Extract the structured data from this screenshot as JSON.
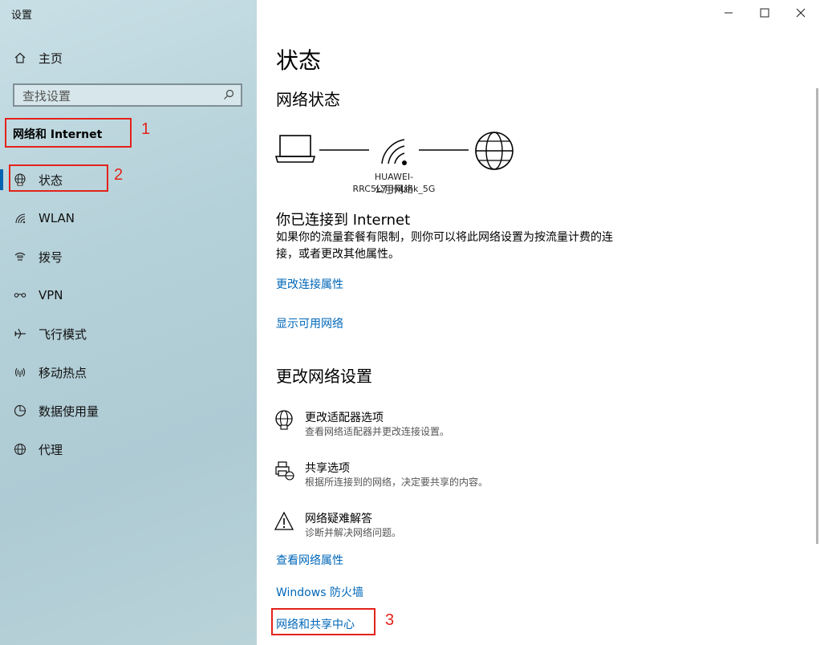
{
  "app_title": "设置",
  "sidebar": {
    "home_label": "主页",
    "search_placeholder": "查找设置",
    "section_label": "网络和 Internet",
    "items": [
      {
        "label": "状态",
        "icon": "globe-status-icon"
      },
      {
        "label": "WLAN",
        "icon": "wifi-icon"
      },
      {
        "label": "拨号",
        "icon": "dialup-icon"
      },
      {
        "label": "VPN",
        "icon": "vpn-icon"
      },
      {
        "label": "飞行模式",
        "icon": "airplane-icon"
      },
      {
        "label": "移动热点",
        "icon": "hotspot-icon"
      },
      {
        "label": "数据使用量",
        "icon": "data-usage-icon"
      },
      {
        "label": "代理",
        "icon": "proxy-globe-icon"
      }
    ]
  },
  "annotations": [
    "1",
    "2",
    "3"
  ],
  "main": {
    "title": "状态",
    "network_status_heading": "网络状态",
    "network_name": "HUAWEI-RRC5L7_HiLink_5G",
    "network_type": "公用网络",
    "connected_title": "你已连接到 Internet",
    "connected_desc": "如果你的流量套餐有限制，则你可以将此网络设置为按流量计费的连接，或者更改其他属性。",
    "links_top": [
      "更改连接属性",
      "显示可用网络"
    ],
    "change_settings_heading": "更改网络设置",
    "options": [
      {
        "title": "更改适配器选项",
        "desc": "查看网络适配器并更改连接设置。",
        "icon": "adapter-globe-icon"
      },
      {
        "title": "共享选项",
        "desc": "根据所连接到的网络，决定要共享的内容。",
        "icon": "sharing-printer-icon"
      },
      {
        "title": "网络疑难解答",
        "desc": "诊断并解决网络问题。",
        "icon": "warning-triangle-icon"
      }
    ],
    "links_bottom": [
      "查看网络属性",
      "Windows 防火墙",
      "网络和共享中心"
    ]
  },
  "colors": {
    "accent": "#0063b1",
    "link": "#0067b8",
    "annotation": "#e2231a"
  }
}
